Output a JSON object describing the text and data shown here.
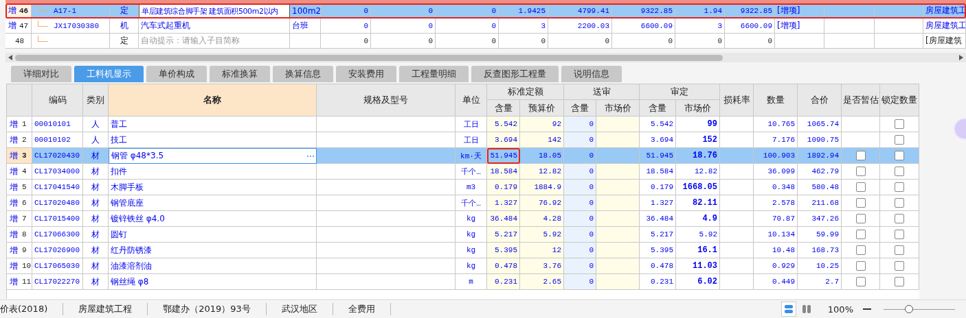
{
  "top_grid": {
    "rows": [
      {
        "kind": "item",
        "mark": "增",
        "number": "46",
        "code": "A17-1",
        "type": "定",
        "name": "单层建筑综合脚手架 建筑面积500m2以内",
        "unit": "100m2",
        "values": [
          "0",
          "0",
          "0",
          "1.9425",
          "4799.41",
          "9322.85",
          "1.94",
          "9322.85"
        ],
        "tag": "[增项]",
        "last": "房屋建筑工",
        "selected": true,
        "outlined": true
      },
      {
        "kind": "item",
        "mark": "增",
        "number": "47",
        "code": "JX17030380",
        "type": "机",
        "name": "汽车式起重机",
        "unit": "台班",
        "values": [
          "0",
          "0",
          "0",
          "3",
          "2200.03",
          "6600.09",
          "3",
          "6600.09"
        ],
        "tag": "[增项]",
        "last": "房屋建筑工",
        "selected": false,
        "outlined": false
      },
      {
        "kind": "new",
        "number": "48",
        "type": "定",
        "placeholder": "自动提示：请输入子目简称",
        "values": [
          "0",
          "0",
          "0",
          "0",
          "0",
          "0",
          "0",
          "0"
        ],
        "last": "[房屋建筑",
        "selected": false,
        "outlined": false
      }
    ]
  },
  "tabs": [
    {
      "label": "详细对比",
      "selected": false
    },
    {
      "label": "工料机显示",
      "selected": true
    },
    {
      "label": "单价构成",
      "selected": false
    },
    {
      "label": "标准换算",
      "selected": false
    },
    {
      "label": "换算信息",
      "selected": false
    },
    {
      "label": "安装费用",
      "selected": false
    },
    {
      "label": "工程量明细",
      "selected": false
    },
    {
      "label": "反查图形工程量",
      "selected": false
    },
    {
      "label": "说明信息",
      "selected": false
    }
  ],
  "resource_table": {
    "columns": [
      {
        "label": "编码",
        "selected": false
      },
      {
        "label": "类别",
        "selected": false
      },
      {
        "label": "名称",
        "selected": true
      },
      {
        "label": "规格及型号",
        "selected": false
      },
      {
        "label": "单位",
        "selected": false
      },
      {
        "label": "标准定额",
        "sub": [
          "含量",
          "预算价"
        ]
      },
      {
        "label": "送审",
        "sub": [
          "含量",
          "市场价"
        ]
      },
      {
        "label": "审定",
        "sub": [
          "含量",
          "市场价"
        ]
      },
      {
        "label": "损耗率",
        "selected": false
      },
      {
        "label": "数量",
        "selected": false
      },
      {
        "label": "合价",
        "selected": false
      },
      {
        "label": "是否暂估",
        "selected": false
      },
      {
        "label": "锁定数量",
        "selected": false
      }
    ],
    "rows": [
      {
        "mark": "增",
        "number": "1",
        "code": "00010101",
        "type": "人",
        "name": "普工",
        "unit": "工日",
        "std_qty": "5.542",
        "std_price": "92",
        "sub_qty": "0",
        "app_qty": "5.542",
        "app_price": "99",
        "adjusted": true,
        "quantity": "10.765",
        "total": "1065.74",
        "locked": false,
        "selected": false,
        "outlined": false
      },
      {
        "mark": "增",
        "number": "2",
        "code": "00010102",
        "type": "人",
        "name": "技工",
        "unit": "工日",
        "std_qty": "3.694",
        "std_price": "142",
        "sub_qty": "0",
        "app_qty": "3.694",
        "app_price": "152",
        "adjusted": true,
        "quantity": "7.176",
        "total": "1090.75",
        "locked": false,
        "selected": false,
        "outlined": false
      },
      {
        "mark": "增",
        "number": "3",
        "code": "CL17020430",
        "type": "材",
        "name": "钢管 φ48*3.5",
        "unit": "km·天",
        "std_qty": "51.945",
        "std_price": "18.05",
        "sub_qty": "0",
        "app_qty": "51.945",
        "app_price": "18.76",
        "adjusted": true,
        "quantity": "100.903",
        "total": "1892.94",
        "estimate": false,
        "locked": false,
        "selected": true,
        "outlined": true
      },
      {
        "mark": "增",
        "number": "4",
        "code": "CL17034000",
        "type": "材",
        "name": "扣件",
        "unit": "千个…",
        "std_qty": "18.584",
        "std_price": "12.82",
        "sub_qty": "0",
        "app_qty": "18.584",
        "app_price": "12.82",
        "adjusted": false,
        "quantity": "36.099",
        "total": "462.79",
        "estimate": false,
        "locked": false,
        "selected": false,
        "outlined": false
      },
      {
        "mark": "增",
        "number": "5",
        "code": "CL17041540",
        "type": "材",
        "name": "木脚手板",
        "unit": "m3",
        "std_qty": "0.179",
        "std_price": "1884.9",
        "sub_qty": "0",
        "app_qty": "0.179",
        "app_price": "1668.05",
        "adjusted": true,
        "quantity": "0.348",
        "total": "580.48",
        "estimate": false,
        "locked": false,
        "selected": false,
        "outlined": false
      },
      {
        "mark": "增",
        "number": "6",
        "code": "CL17020480",
        "type": "材",
        "name": "钢管底座",
        "unit": "千个…",
        "std_qty": "1.327",
        "std_price": "76.92",
        "sub_qty": "0",
        "app_qty": "1.327",
        "app_price": "82.11",
        "adjusted": true,
        "quantity": "2.578",
        "total": "211.68",
        "estimate": false,
        "locked": false,
        "selected": false,
        "outlined": false
      },
      {
        "mark": "增",
        "number": "7",
        "code": "CL17015400",
        "type": "材",
        "name": "镀锌铁丝 φ4.0",
        "unit": "kg",
        "std_qty": "36.484",
        "std_price": "4.28",
        "sub_qty": "0",
        "app_qty": "36.484",
        "app_price": "4.9",
        "adjusted": true,
        "quantity": "70.87",
        "total": "347.26",
        "estimate": false,
        "locked": false,
        "selected": false,
        "outlined": false
      },
      {
        "mark": "增",
        "number": "8",
        "code": "CL17066300",
        "type": "材",
        "name": "圆钉",
        "unit": "kg",
        "std_qty": "5.217",
        "std_price": "5.92",
        "sub_qty": "0",
        "app_qty": "5.217",
        "app_price": "5.92",
        "adjusted": false,
        "quantity": "10.134",
        "total": "59.99",
        "estimate": false,
        "locked": false,
        "selected": false,
        "outlined": false
      },
      {
        "mark": "增",
        "number": "9",
        "code": "CL17026900",
        "type": "材",
        "name": "红丹防锈漆",
        "unit": "kg",
        "std_qty": "5.395",
        "std_price": "12",
        "sub_qty": "0",
        "app_qty": "5.395",
        "app_price": "16.1",
        "adjusted": true,
        "quantity": "10.48",
        "total": "168.73",
        "estimate": false,
        "locked": false,
        "selected": false,
        "outlined": false
      },
      {
        "mark": "增",
        "number": "10",
        "code": "CL17065030",
        "type": "材",
        "name": "油漆溶剂油",
        "unit": "kg",
        "std_qty": "0.478",
        "std_price": "3.76",
        "sub_qty": "0",
        "app_qty": "0.478",
        "app_price": "11.03",
        "adjusted": true,
        "quantity": "0.929",
        "total": "10.25",
        "estimate": false,
        "locked": false,
        "selected": false,
        "outlined": false
      },
      {
        "mark": "增",
        "number": "11",
        "code": "CL17022270",
        "type": "材",
        "name": "钢丝绳 φ8",
        "unit": "m",
        "std_qty": "0.231",
        "std_price": "2.65",
        "sub_qty": "0",
        "app_qty": "0.231",
        "app_price": "6.02",
        "adjusted": true,
        "quantity": "0.449",
        "total": "2.7",
        "estimate": false,
        "locked": false,
        "selected": false,
        "outlined": false
      }
    ]
  },
  "status_bar": {
    "items": [
      "价表(2018)",
      "房屋建筑工程",
      "鄂建办（2019）93号",
      "武汉地区",
      "全费用"
    ],
    "view_modes": [
      {
        "kind": "rows",
        "selected": true
      },
      {
        "kind": "columns",
        "selected": false
      }
    ],
    "zoom": "100%",
    "zoom_slider": {
      "level": 0.36
    }
  }
}
